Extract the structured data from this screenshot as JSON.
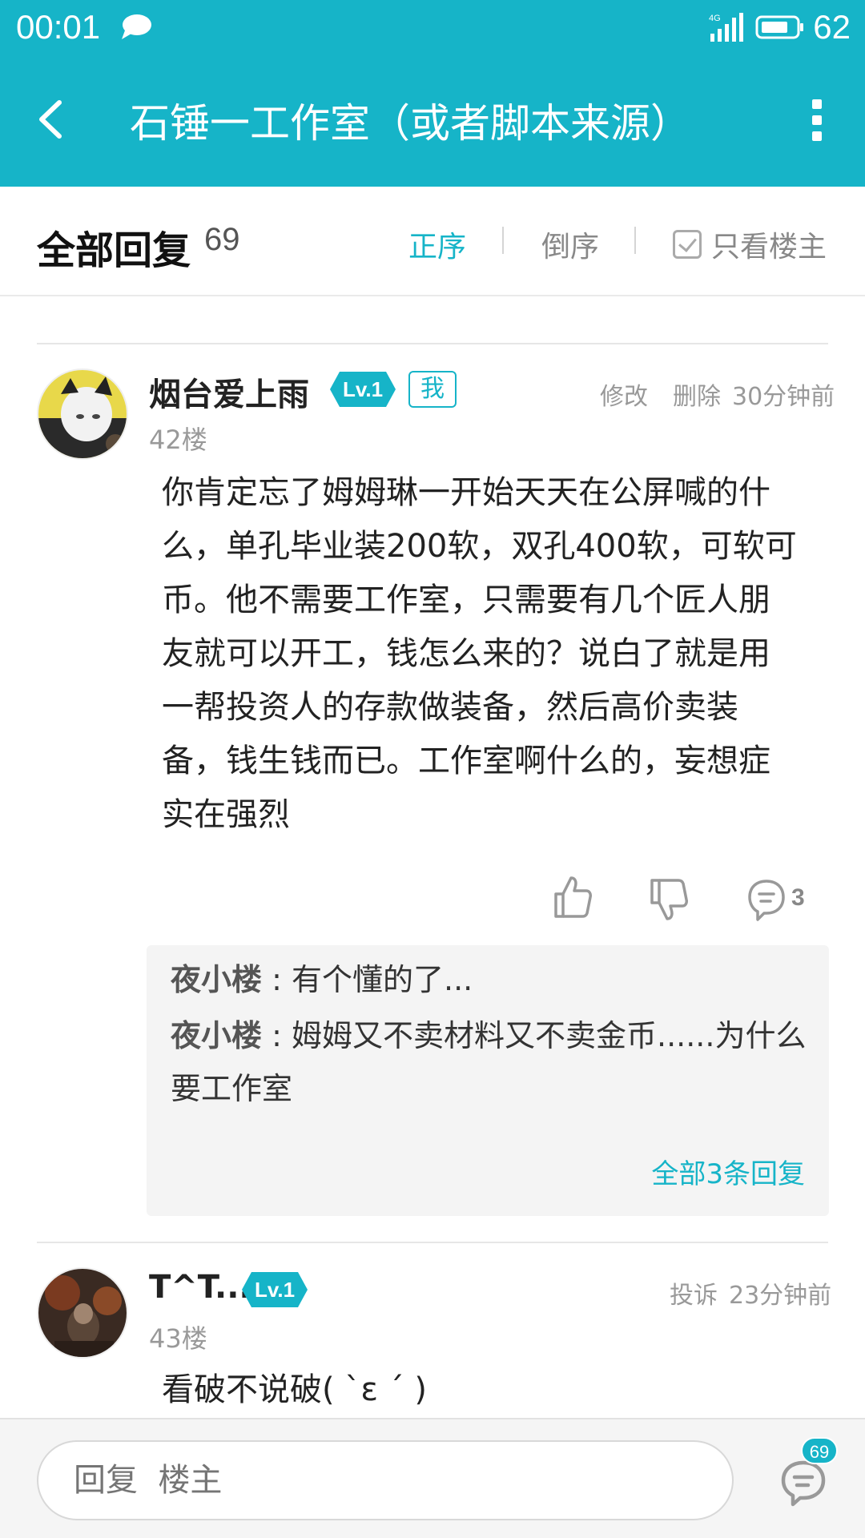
{
  "status_bar": {
    "time": "00:01",
    "network": "4G",
    "battery": "62"
  },
  "header": {
    "title": "石锤一工作室（或者脚本来源）"
  },
  "filter": {
    "title": "全部回复",
    "count": "69",
    "sort_asc": "正序",
    "sort_desc": "倒序",
    "only_op": "只看楼主"
  },
  "posts": [
    {
      "username": "烟台爱上雨",
      "level": "Lv.1",
      "me_badge": "我",
      "edit": "修改",
      "delete": "删除",
      "time": "30分钟前",
      "floor": "42楼",
      "content_lines": [
        "你肯定忘了姆姆琳一开始天天在公屏喊的什",
        "么，单孔毕业装200软，双孔400软，可软可",
        "币。他不需要工作室，只需要有几个匠人朋",
        "友就可以开工，钱怎么来的？说白了就是用",
        "一帮投资人的存款做装备，然后高价卖装",
        "备，钱生钱而已。工作室啊什么的，妄想症",
        "实在强烈"
      ],
      "reply_count": "3",
      "sub_replies": [
        {
          "name": "夜小楼",
          "sep": " : ",
          "text": "有个懂的了..."
        },
        {
          "name": "夜小楼",
          "sep": " : ",
          "text": "姆姆又不卖材料又不卖金币......为什么要工作室"
        }
      ],
      "all_replies": "全部3条回复"
    },
    {
      "username": "T^T...",
      "level": "Lv.1",
      "report": "投诉",
      "time": "23分钟前",
      "floor": "43楼",
      "content": "看破不说破( ˋε ˊ )"
    }
  ],
  "bottom": {
    "placeholder": "回复  楼主",
    "comment_badge": "69"
  },
  "colors": {
    "accent": "#16b4c8"
  }
}
